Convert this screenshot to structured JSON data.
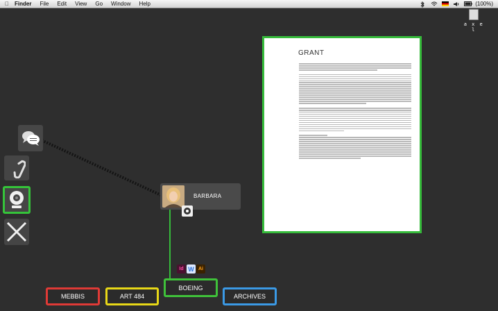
{
  "menubar": {
    "app_name": "Finder",
    "menus": [
      "File",
      "Edit",
      "View",
      "Go",
      "Window",
      "Help"
    ],
    "battery_text": "(100%)"
  },
  "desktop_icon": {
    "label": "a x e l"
  },
  "contact": {
    "name": "BARBARA"
  },
  "document": {
    "title": "GRANT"
  },
  "app_icons": [
    {
      "label": "Id",
      "color": "#c9227d"
    },
    {
      "label": "W",
      "color": "#2b6fd6"
    },
    {
      "label": "Ai",
      "color": "#f29a1a"
    }
  ],
  "folders": [
    {
      "label": "MEBBIS",
      "color": "#e03a36"
    },
    {
      "label": "ART 484",
      "color": "#e8d817"
    },
    {
      "label": "BOEING",
      "color": "#3fc23a"
    },
    {
      "label": "ARCHIVES",
      "color": "#3b9ae6"
    }
  ],
  "colors": {
    "active_green": "#36bb3b",
    "background": "#2e2e2e"
  }
}
